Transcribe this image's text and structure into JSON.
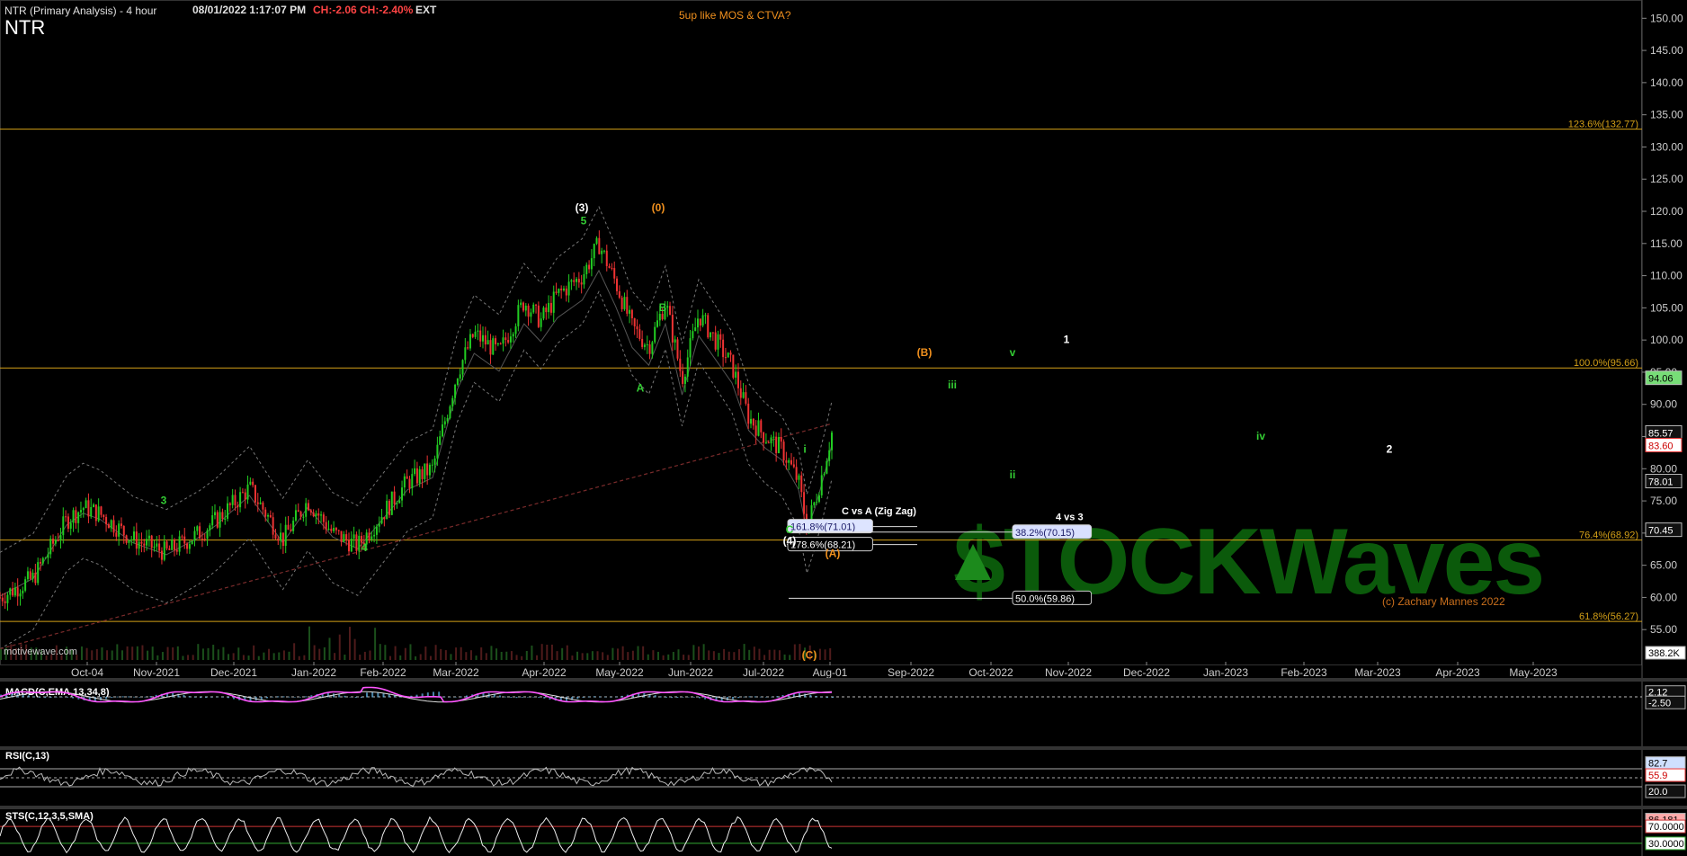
{
  "header": {
    "title": "NTR (Primary Analysis) - 4 hour",
    "datetime": "08/01/2022 1:17:07 PM",
    "ch_abs": "CH:-2.06",
    "ch_pct": "CH:-2.40%",
    "ext": "EXT",
    "symbol": "NTR",
    "note": "5up like MOS & CTVA?",
    "source": "motivewave.com",
    "copyright": "(c) Zachary Mannes 2022",
    "logo_text": "$TOCKWaves"
  },
  "colors": {
    "background": "#000000",
    "up_candle": "#22cc22",
    "down_candle": "#ee3333",
    "fib_line": "#d4a017",
    "green_label": "#33cc33",
    "orange_label": "#f0901e",
    "macd_line": "#ff55ff",
    "histogram": "#66bbee",
    "last_price_badge": "#77dd77"
  },
  "chart_data": [
    {
      "type": "candlestick",
      "panel": "price",
      "x_axis_labels": [
        "Oct-04",
        "Nov-2021",
        "Dec-2021",
        "Jan-2022",
        "Feb-2022",
        "Mar-2022",
        "Apr-2022",
        "May-2022",
        "Jun-2022",
        "Jul-2022",
        "Aug-01",
        "Sep-2022",
        "Oct-2022",
        "Nov-2022",
        "Dec-2022",
        "Jan-2023",
        "Feb-2023",
        "Mar-2023",
        "Apr-2023",
        "May-2023"
      ],
      "y_axis": {
        "min": 50,
        "max": 152,
        "ticks": [
          55,
          60,
          65,
          70,
          75,
          80,
          85,
          90,
          95,
          100,
          105,
          110,
          115,
          120,
          125,
          130,
          135,
          140,
          145,
          150
        ]
      },
      "price_path": [
        [
          0,
          60
        ],
        [
          0.04,
          63
        ],
        [
          0.08,
          72
        ],
        [
          0.1,
          74
        ],
        [
          0.12,
          73
        ],
        [
          0.14,
          71
        ],
        [
          0.16,
          69
        ],
        [
          0.2,
          67
        ],
        [
          0.24,
          70
        ],
        [
          0.26,
          72
        ],
        [
          0.3,
          77
        ],
        [
          0.32,
          73
        ],
        [
          0.34,
          69
        ],
        [
          0.37,
          75
        ],
        [
          0.4,
          70
        ],
        [
          0.43,
          68
        ],
        [
          0.46,
          73
        ],
        [
          0.49,
          78
        ],
        [
          0.52,
          80
        ],
        [
          0.55,
          95
        ],
        [
          0.57,
          101
        ],
        [
          0.6,
          98
        ],
        [
          0.63,
          106
        ],
        [
          0.65,
          103
        ],
        [
          0.67,
          107
        ],
        [
          0.7,
          110
        ],
        [
          0.72,
          115
        ],
        [
          0.74,
          109
        ],
        [
          0.76,
          102
        ],
        [
          0.78,
          99
        ],
        [
          0.8,
          106
        ],
        [
          0.82,
          94
        ],
        [
          0.84,
          104
        ],
        [
          0.86,
          100
        ],
        [
          0.88,
          96
        ],
        [
          0.9,
          88
        ],
        [
          0.92,
          85
        ],
        [
          0.94,
          83
        ],
        [
          0.96,
          78
        ],
        [
          0.97,
          71
        ],
        [
          0.98,
          75
        ],
        [
          0.99,
          80
        ],
        [
          1.0,
          85.57
        ]
      ],
      "fib_levels": [
        {
          "label": "123.6%(132.77)",
          "value": 132.77
        },
        {
          "label": "100.0%(95.66)",
          "value": 95.66
        },
        {
          "label": "76.4%(68.92)",
          "value": 68.92
        },
        {
          "label": "61.8%(56.27)",
          "value": 56.27
        }
      ],
      "projection_boxes": [
        {
          "label": "161.8%(71.01)",
          "value": 71.01
        },
        {
          "label": "178.6%(68.21)",
          "value": 68.21
        },
        {
          "label": "38.2%(70.15)",
          "value": 70.15
        },
        {
          "label": "50.0%(59.86)",
          "value": 59.86
        }
      ],
      "annotations": [
        {
          "text": "C vs A (Zig Zag)",
          "value": 73.5
        },
        {
          "text": "4 vs 3",
          "value": 72.6
        }
      ],
      "wave_labels": [
        {
          "text": "3",
          "value": 74.5,
          "color": "green"
        },
        {
          "text": "4",
          "value": 67.2,
          "color": "green"
        },
        {
          "text": "(3)",
          "value": 120,
          "color": "white"
        },
        {
          "text": "5",
          "value": 118,
          "color": "green"
        },
        {
          "text": "(0)",
          "value": 120,
          "color": "orange"
        },
        {
          "text": "B",
          "value": 104.5,
          "color": "green"
        },
        {
          "text": "A",
          "value": 92,
          "color": "green"
        },
        {
          "text": "C",
          "value": 70,
          "color": "green"
        },
        {
          "text": "(4)",
          "value": 68.2,
          "color": "white"
        },
        {
          "text": "(A)",
          "value": 66.3,
          "color": "orange"
        },
        {
          "text": "i",
          "value": 82.5,
          "color": "green"
        },
        {
          "text": "ii",
          "value": 78.5,
          "color": "green"
        },
        {
          "text": "1",
          "value": 99.5,
          "color": "white"
        },
        {
          "text": "v",
          "value": 97.5,
          "color": "green"
        },
        {
          "text": "(B)",
          "value": 97.5,
          "color": "orange"
        },
        {
          "text": "iii",
          "value": 92.5,
          "color": "green"
        },
        {
          "text": "iv",
          "value": 84.5,
          "color": "green"
        },
        {
          "text": "2",
          "value": 82.5,
          "color": "white"
        },
        {
          "text": "(C)",
          "value": 50.5,
          "color": "orange"
        }
      ],
      "price_badges": [
        {
          "text": "94.06",
          "value": 94.06,
          "style": "green"
        },
        {
          "text": "85.57",
          "value": 85.57,
          "style": "plain"
        },
        {
          "text": "83.60",
          "value": 83.6,
          "style": "red"
        },
        {
          "text": "78.01",
          "value": 78.01,
          "style": "plain"
        },
        {
          "text": "70.45",
          "value": 70.45,
          "style": "plain"
        }
      ],
      "volume_badge": "388.2K"
    },
    {
      "type": "line",
      "panel": "macd",
      "title": "MACD(C,EMA,13,34,8)",
      "badges": [
        {
          "text": "2.12",
          "value": 2.12
        },
        {
          "text": "-2.50",
          "value": -2.5
        }
      ],
      "ylim": [
        -6,
        6
      ]
    },
    {
      "type": "line",
      "panel": "rsi",
      "title": "RSI(C,13)",
      "badges": [
        {
          "text": "82.7",
          "value": 82.7
        },
        {
          "text": "55.9",
          "value": 55.9
        },
        {
          "text": "20.0",
          "value": 20.0
        }
      ],
      "ylim": [
        0,
        100
      ]
    },
    {
      "type": "line",
      "panel": "stochastic",
      "title": "STS(C,12,3,5,SMA)",
      "badges": [
        {
          "text": "86.181",
          "value": 86.181
        },
        {
          "text": "70.0000",
          "value": 70
        },
        {
          "text": "30.0000",
          "value": 30
        }
      ],
      "ylim": [
        0,
        100
      ]
    }
  ]
}
